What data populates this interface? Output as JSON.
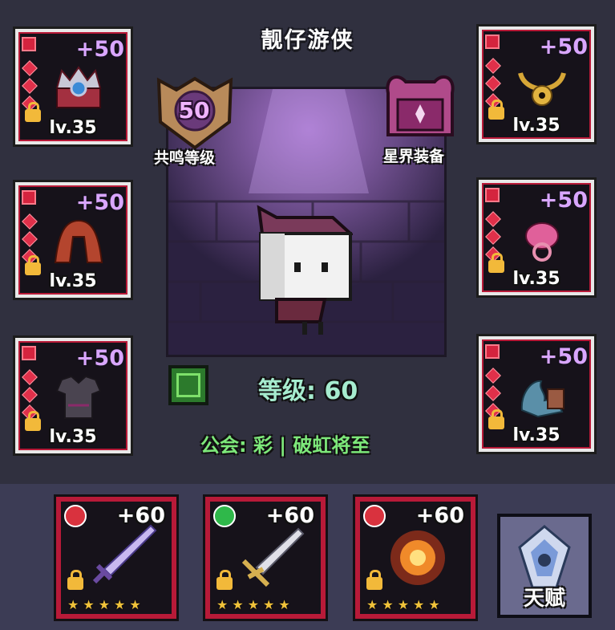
{
  "character": {
    "name": "靓仔游侠",
    "level_text": "等级: 60",
    "guild_text": "公会: 彩 | 破虹将至"
  },
  "resonance": {
    "value": "50",
    "label": "共鸣等级"
  },
  "astral": {
    "label": "星界装备"
  },
  "equipment": [
    {
      "id": "helmet",
      "bonus": "+50",
      "level": "lv.35",
      "icon": "crown-helmet-icon"
    },
    {
      "id": "cloak",
      "bonus": "+50",
      "level": "lv.35",
      "icon": "cloak-icon"
    },
    {
      "id": "armor",
      "bonus": "+50",
      "level": "lv.35",
      "icon": "armor-icon"
    },
    {
      "id": "necklace",
      "bonus": "+50",
      "level": "lv.35",
      "icon": "gold-necklace-icon"
    },
    {
      "id": "ring",
      "bonus": "+50",
      "level": "lv.35",
      "icon": "pink-ring-icon"
    },
    {
      "id": "pet",
      "bonus": "+50",
      "level": "lv.35",
      "icon": "dragon-pet-icon"
    }
  ],
  "weapons": [
    {
      "bonus": "+60",
      "stars": "★★★★★",
      "icon": "rainbow-sword-icon",
      "element_color": "#d9323e"
    },
    {
      "bonus": "+60",
      "stars": "★★★★★",
      "icon": "crossbow-icon",
      "element_color": "#2fb84a"
    },
    {
      "bonus": "+60",
      "stars": "★★★★★",
      "icon": "flame-orb-icon",
      "element_color": "#d9323e"
    }
  ],
  "talent": {
    "label": "天赋",
    "icon": "talent-emblem-icon"
  }
}
